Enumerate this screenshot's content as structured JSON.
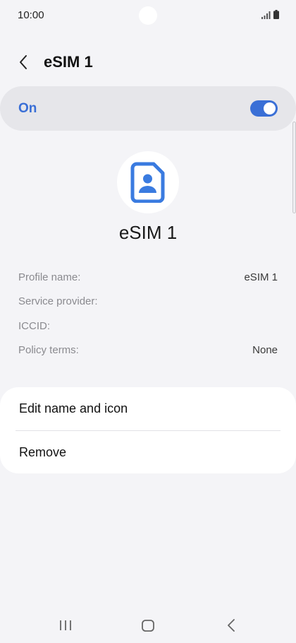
{
  "status_bar": {
    "time": "10:00",
    "signal_icon": "signal-bars-icon",
    "battery_icon": "battery-icon"
  },
  "header": {
    "back_icon": "chevron-left-icon",
    "title": "eSIM 1"
  },
  "toggle": {
    "label": "On",
    "state": "on",
    "accent_color": "#3a6fd6"
  },
  "profile": {
    "icon": "sim-card-person-icon",
    "name": "eSIM 1"
  },
  "info": [
    {
      "label": "Profile name:",
      "value": "eSIM 1"
    },
    {
      "label": "Service provider:",
      "value": ""
    },
    {
      "label": "ICCID:",
      "value": ""
    },
    {
      "label": "Policy terms:",
      "value": "None"
    }
  ],
  "actions": {
    "edit_label": "Edit name and icon",
    "remove_label": "Remove"
  },
  "nav": {
    "recents_icon": "recents-icon",
    "home_icon": "home-icon",
    "back_icon": "back-icon"
  }
}
